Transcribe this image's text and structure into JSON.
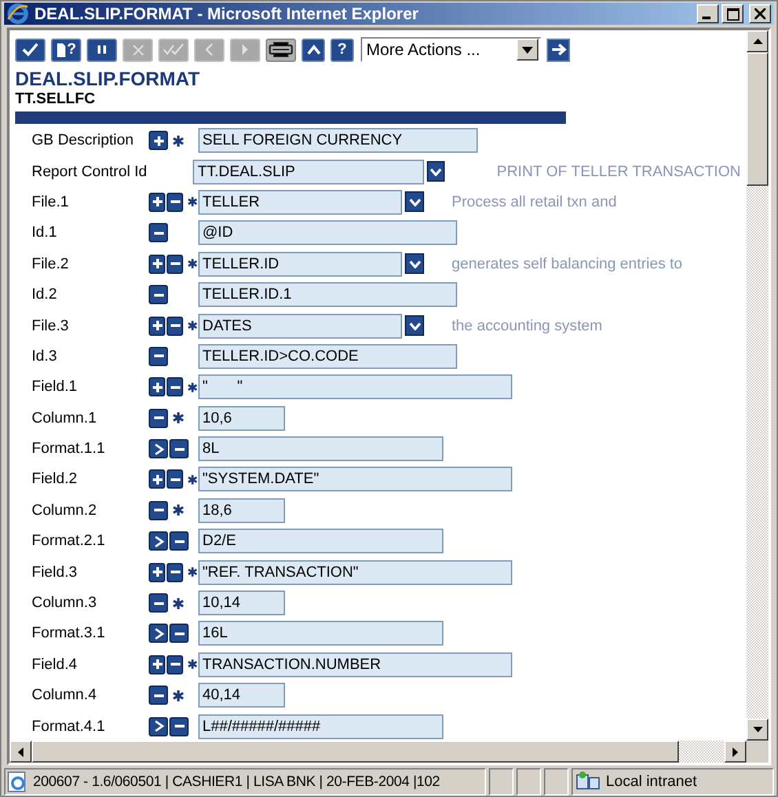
{
  "window": {
    "title": "DEAL.SLIP.FORMAT - Microsoft Internet Explorer"
  },
  "toolbar": {
    "buttons": [
      {
        "kind": "commit",
        "disabled": false
      },
      {
        "kind": "query",
        "disabled": false,
        "label": "?"
      },
      {
        "kind": "hold",
        "disabled": false
      },
      {
        "kind": "delete",
        "disabled": true
      },
      {
        "kind": "authorise",
        "disabled": true
      },
      {
        "kind": "previous",
        "disabled": true
      },
      {
        "kind": "next",
        "disabled": true
      },
      {
        "kind": "print",
        "disabled": false
      },
      {
        "kind": "up",
        "disabled": false
      },
      {
        "kind": "help",
        "disabled": false,
        "label": "?"
      }
    ],
    "actions": {
      "value": "More Actions ..."
    }
  },
  "heading": {
    "title": "DEAL.SLIP.FORMAT",
    "record_id": "TT.SELLFC"
  },
  "rows": [
    {
      "kind": "description",
      "label": "GB Description",
      "buttons": [
        {
          "kind": "plus"
        }
      ],
      "required": true,
      "value": "SELL FOREIGN CURRENCY",
      "dropdown": false
    },
    {
      "kind": "control",
      "label": "Report Control Id",
      "buttons": [],
      "required": false,
      "value": "TT.DEAL.SLIP",
      "dropdown": true,
      "note": "PRINT OF TELLER TRANSACTION"
    },
    {
      "kind": "file",
      "label": "File.1",
      "buttons": [
        {
          "kind": "plus"
        },
        {
          "kind": "minus"
        }
      ],
      "required": true,
      "value": "TELLER",
      "dropdown": true,
      "note": "Process all retail txn and"
    },
    {
      "kind": "id",
      "label": "Id.1",
      "buttons": [
        {
          "kind": "minus"
        }
      ],
      "required": false,
      "value": "@ID",
      "dropdown": false
    },
    {
      "kind": "file",
      "label": "File.2",
      "buttons": [
        {
          "kind": "plus"
        },
        {
          "kind": "minus"
        }
      ],
      "required": true,
      "value": "TELLER.ID",
      "dropdown": true,
      "note": "generates self balancing entries to"
    },
    {
      "kind": "id",
      "label": "Id.2",
      "buttons": [
        {
          "kind": "minus"
        }
      ],
      "required": false,
      "value": "TELLER.ID.1",
      "dropdown": false
    },
    {
      "kind": "file",
      "label": "File.3",
      "buttons": [
        {
          "kind": "plus"
        },
        {
          "kind": "minus"
        }
      ],
      "required": true,
      "value": "DATES",
      "dropdown": true,
      "note": "the accounting system"
    },
    {
      "kind": "id",
      "label": "Id.3",
      "buttons": [
        {
          "kind": "minus"
        }
      ],
      "required": false,
      "value": "TELLER.ID>CO.CODE",
      "dropdown": false
    },
    {
      "kind": "field",
      "label": "Field.1",
      "buttons": [
        {
          "kind": "plus"
        },
        {
          "kind": "minus"
        }
      ],
      "required": true,
      "value": "\"       \"",
      "dropdown": false
    },
    {
      "kind": "column",
      "label": "Column.1",
      "buttons": [
        {
          "kind": "minus"
        }
      ],
      "required": true,
      "value": "10,6",
      "dropdown": false
    },
    {
      "kind": "format",
      "label": "Format.1.1",
      "buttons": [
        {
          "kind": "expand"
        },
        {
          "kind": "minus"
        }
      ],
      "required": false,
      "value": "8L",
      "dropdown": false
    },
    {
      "kind": "field",
      "label": "Field.2",
      "buttons": [
        {
          "kind": "plus"
        },
        {
          "kind": "minus"
        }
      ],
      "required": true,
      "value": "\"SYSTEM.DATE\"",
      "dropdown": false
    },
    {
      "kind": "column",
      "label": "Column.2",
      "buttons": [
        {
          "kind": "minus"
        }
      ],
      "required": true,
      "value": "18,6",
      "dropdown": false
    },
    {
      "kind": "format",
      "label": "Format.2.1",
      "buttons": [
        {
          "kind": "expand"
        },
        {
          "kind": "minus"
        }
      ],
      "required": false,
      "value": "D2/E",
      "dropdown": false
    },
    {
      "kind": "field",
      "label": "Field.3",
      "buttons": [
        {
          "kind": "plus"
        },
        {
          "kind": "minus"
        }
      ],
      "required": true,
      "value": "\"REF. TRANSACTION\"",
      "dropdown": false
    },
    {
      "kind": "column",
      "label": "Column.3",
      "buttons": [
        {
          "kind": "minus"
        }
      ],
      "required": true,
      "value": "10,14",
      "dropdown": false
    },
    {
      "kind": "format",
      "label": "Format.3.1",
      "buttons": [
        {
          "kind": "expand"
        },
        {
          "kind": "minus"
        }
      ],
      "required": false,
      "value": "16L",
      "dropdown": false
    },
    {
      "kind": "field",
      "label": "Field.4",
      "buttons": [
        {
          "kind": "plus"
        },
        {
          "kind": "minus"
        }
      ],
      "required": true,
      "value": "TRANSACTION.NUMBER",
      "dropdown": false
    },
    {
      "kind": "column",
      "label": "Column.4",
      "buttons": [
        {
          "kind": "minus"
        }
      ],
      "required": true,
      "value": "40,14",
      "dropdown": false
    },
    {
      "kind": "format",
      "label": "Format.4.1",
      "buttons": [
        {
          "kind": "expand"
        },
        {
          "kind": "minus"
        }
      ],
      "required": false,
      "value": "L##/#####/#####",
      "dropdown": false
    }
  ],
  "status_bar": {
    "text": "200607 - 1.6/060501 | CASHIER1 | LISA BNK | 20-FEB-2004 |102",
    "zone": "Local intranet"
  }
}
